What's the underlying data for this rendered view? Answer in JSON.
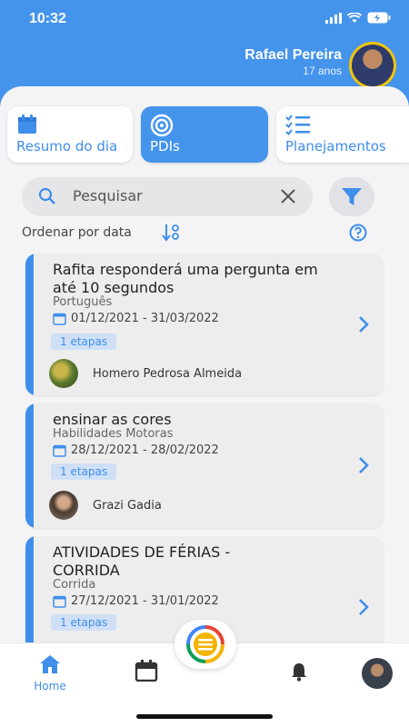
{
  "status_bar": {
    "time": "10:32"
  },
  "header": {
    "user_name": "Rafael Pereira",
    "user_age": "17 anos"
  },
  "tabs": [
    {
      "label": "Resumo do dia",
      "icon": "calendar-icon",
      "active": false
    },
    {
      "label": "PDIs",
      "icon": "target-icon",
      "active": true
    },
    {
      "label": "Planejamentos",
      "icon": "checklist-icon",
      "active": false
    }
  ],
  "search": {
    "placeholder": "Pesquisar",
    "value": ""
  },
  "sort": {
    "label": "Ordenar por data"
  },
  "cards": [
    {
      "title": "Rafita responderá uma pergunta em até 10 segundos",
      "category": "Português",
      "dates": "01/12/2021 - 31/03/2022",
      "stages": "1 etapas",
      "person": "Homero Pedrosa Almeida"
    },
    {
      "title": "ensinar as cores",
      "category": "Habilidades Motoras",
      "dates": "28/12/2021 - 28/02/2022",
      "stages": "1 etapas",
      "person": "Grazi Gadia"
    },
    {
      "title": "ATIVIDADES DE FÉRIAS - CORRIDA",
      "category": "Corrida",
      "dates": "27/12/2021 - 31/01/2022",
      "stages": "1 etapas",
      "person": ""
    }
  ],
  "bottom_nav": {
    "home_label": "Home"
  },
  "colors": {
    "primary": "#4594ec",
    "accent_text": "#3f8ee9",
    "stage_badge": "#cfe0f6"
  }
}
